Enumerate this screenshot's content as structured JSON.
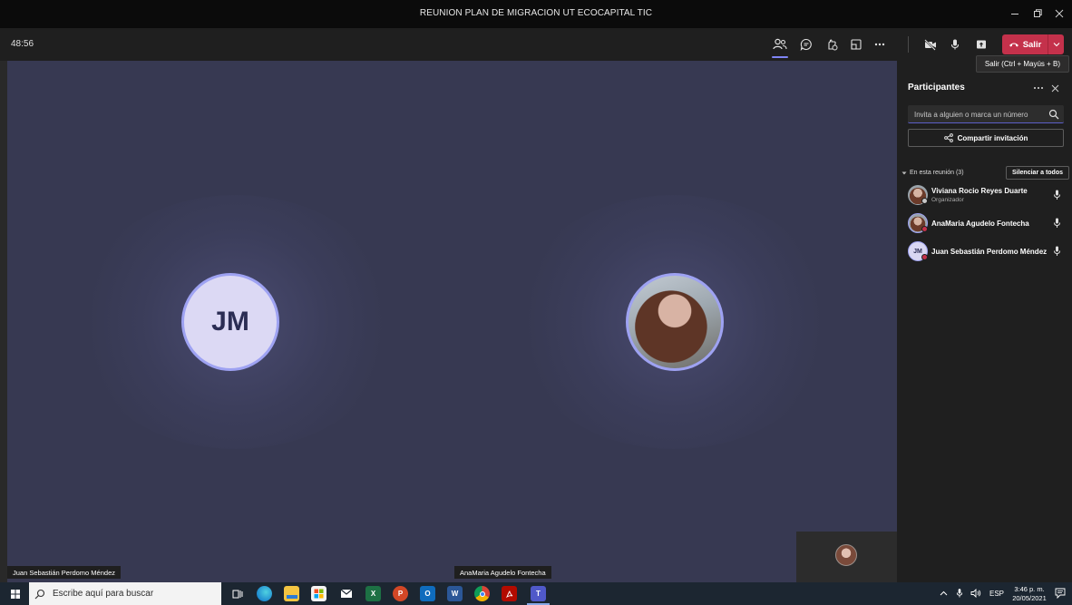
{
  "window": {
    "title": "REUNION PLAN DE MIGRACION UT ECOCAPITAL TIC",
    "controls": [
      "minimize-icon",
      "maximize-icon",
      "close-icon"
    ]
  },
  "toolbar": {
    "timer": "48:56",
    "buttons": [
      "participants-icon",
      "chat-icon",
      "reactions-icon",
      "rooms-icon",
      "more-icon",
      "camera-off-icon",
      "mic-icon",
      "share-tray-icon"
    ],
    "leave_label": "Salir",
    "leave_tooltip": "Salir (Ctrl + Mayús + B)",
    "accent_color": "#7f85f5",
    "leave_color": "#c4314b"
  },
  "stage": {
    "tiles": [
      {
        "initials": "JM",
        "name": "Juan Sebastián Perdomo Méndez"
      },
      {
        "initials": "",
        "name": "AnaMaria Agudelo Fontecha"
      }
    ]
  },
  "panel": {
    "title": "Participantes",
    "invite_placeholder": "Invita a alguien o marca un número",
    "share_label": "Compartir invitación",
    "section_label": "En esta reunión (3)",
    "mute_all_label": "Silenciar a todos",
    "participants": [
      {
        "name": "Viviana Rocio Reyes Duarte",
        "role": "Organizador",
        "initials": "",
        "status_color": "#c8c8c8"
      },
      {
        "name": "AnaMaria Agudelo Fontecha",
        "role": "",
        "initials": "",
        "status_color": "#c4314b"
      },
      {
        "name": "Juan Sebastián Perdomo Méndez",
        "role": "",
        "initials": "JM",
        "status_color": "#c4314b"
      }
    ]
  },
  "taskbar": {
    "search_placeholder": "Escribe aquí para buscar",
    "apps": [
      "task-view-icon",
      "edge-icon",
      "file-explorer-icon",
      "store-icon",
      "mail-icon",
      "excel-icon",
      "powerpoint-icon",
      "outlook-icon",
      "word-icon",
      "chrome-icon",
      "acrobat-icon",
      "teams-icon"
    ],
    "language": "ESP",
    "time": "3:46 p. m.",
    "date": "20/05/2021"
  }
}
